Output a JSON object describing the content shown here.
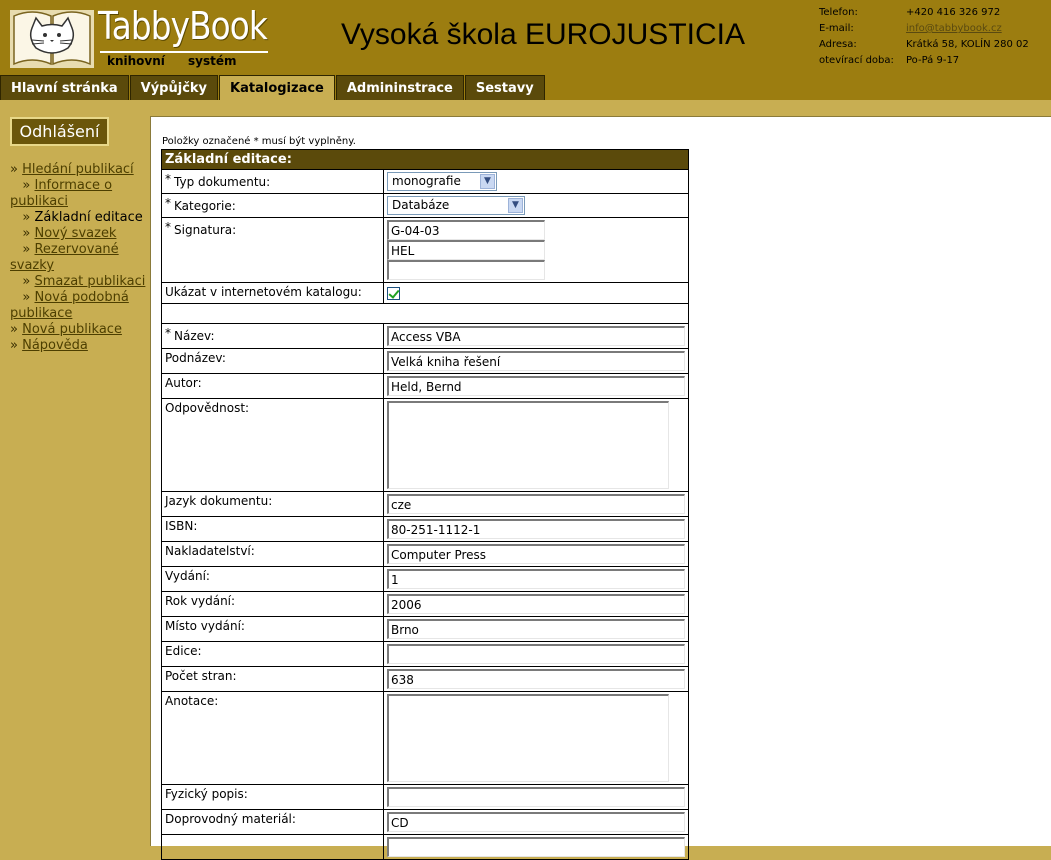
{
  "header": {
    "logo_title": "TabbyBook",
    "logo_sub1": "knihovní",
    "logo_sub2": "systém",
    "school_name": "Vysoká škola EUROJUSTICIA",
    "contact": [
      {
        "label": "Telefon:",
        "value": "+420 416 326 972",
        "link": false
      },
      {
        "label": "E-mail:",
        "value": "info@tabbybook.cz",
        "link": true
      },
      {
        "label": "Adresa:",
        "value": "Krátká 58, KOLÍN 280 02",
        "link": false
      },
      {
        "label": "otevírací doba:",
        "value": "Po-Pá 9-17",
        "link": false
      }
    ]
  },
  "tabs": [
    "Hlavní stránka",
    "Výpůjčky",
    "Katalogizace",
    "Admininstrace",
    "Sestavy"
  ],
  "active_tab": "Katalogizace",
  "sidebar": {
    "logout_label": "Odhlášení",
    "nav": [
      {
        "label": "Hledání publikací",
        "sub": false,
        "current": false
      },
      {
        "label": "Informace o publikaci",
        "sub": true,
        "current": false
      },
      {
        "label": "Základní editace",
        "sub": true,
        "current": true
      },
      {
        "label": "Nový svazek",
        "sub": true,
        "current": false
      },
      {
        "label": "Rezervované svazky",
        "sub": true,
        "current": false
      },
      {
        "label": "Smazat publikaci",
        "sub": true,
        "current": false
      },
      {
        "label": "Nová podobná publikace",
        "sub": true,
        "current": false
      },
      {
        "label": "Nová publikace",
        "sub": false,
        "current": false
      },
      {
        "label": "Nápověda",
        "sub": false,
        "current": false
      }
    ]
  },
  "form": {
    "required_note": "Položky označené * musí být vyplněny.",
    "section_title": "Základní editace:",
    "type_label": "Typ dokumentu:",
    "type_value": "monografie",
    "category_label": "Kategorie:",
    "category_value": "Databáze",
    "signature_label": "Signatura:",
    "signature_values": [
      "G-04-03",
      "HEL",
      ""
    ],
    "show_catalog_label": "Ukázat v internetovém katalogu:",
    "show_catalog_checked": true,
    "title_label": "Název:",
    "title_value": "Access VBA",
    "subtitle_label": "Podnázev:",
    "subtitle_value": "Velká kniha řešení",
    "author_label": "Autor:",
    "author_value": "Held, Bernd",
    "responsibility_label": "Odpovědnost:",
    "responsibility_value": "",
    "language_label": "Jazyk dokumentu:",
    "language_value": "cze",
    "isbn_label": "ISBN:",
    "isbn_value": "80-251-1112-1",
    "publisher_label": "Nakladatelství:",
    "publisher_value": "Computer Press",
    "edition_label": "Vydání:",
    "edition_value": "1",
    "year_label": "Rok vydání:",
    "year_value": "2006",
    "place_label": "Místo vydání:",
    "place_value": "Brno",
    "series_label": "Edice:",
    "series_value": "",
    "pages_label": "Počet stran:",
    "pages_value": "638",
    "annotation_label": "Anotace:",
    "annotation_value": "",
    "physical_label": "Fyzický popis:",
    "physical_value": "",
    "accompanying_label": "Doprovodný materiál:",
    "accompanying_value": "CD"
  }
}
